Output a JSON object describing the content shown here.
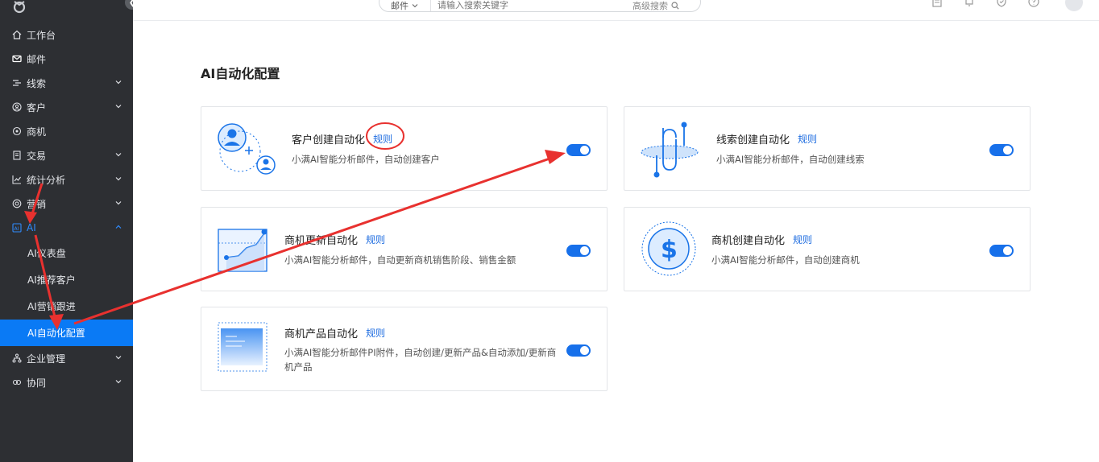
{
  "search": {
    "type_label": "邮件",
    "placeholder": "请输入搜索关键字",
    "advanced_label": "高级搜索"
  },
  "sidebar": {
    "items": [
      {
        "label": "工作台"
      },
      {
        "label": "邮件"
      },
      {
        "label": "线索"
      },
      {
        "label": "客户"
      },
      {
        "label": "商机"
      },
      {
        "label": "交易"
      },
      {
        "label": "统计分析"
      },
      {
        "label": "营销"
      },
      {
        "label": "AI"
      }
    ],
    "ai_sub": [
      {
        "label": "AI仪表盘"
      },
      {
        "label": "AI推荐客户"
      },
      {
        "label": "AI营销跟进"
      },
      {
        "label": "AI自动化配置"
      }
    ],
    "bottom_items": [
      {
        "label": "企业管理"
      },
      {
        "label": "协同"
      }
    ]
  },
  "page": {
    "title": "AI自动化配置"
  },
  "cards": [
    {
      "title": "客户创建自动化",
      "rule": "规则",
      "desc": "小满AI智能分析邮件，自动创建客户",
      "enabled": true
    },
    {
      "title": "线索创建自动化",
      "rule": "规则",
      "desc": "小满AI智能分析邮件，自动创建线索",
      "enabled": true
    },
    {
      "title": "商机更新自动化",
      "rule": "规则",
      "desc": "小满AI智能分析邮件，自动更新商机销售阶段、销售金额",
      "enabled": true
    },
    {
      "title": "商机创建自动化",
      "rule": "规则",
      "desc": "小满AI智能分析邮件，自动创建商机",
      "enabled": true
    },
    {
      "title": "商机产品自动化",
      "rule": "规则",
      "desc": "小满AI智能分析邮件PI附件，自动创建/更新产品&自动添加/更新商机产品",
      "enabled": true
    }
  ],
  "colors": {
    "sidebar_bg": "#2d2f33",
    "accent": "#0a7af5",
    "toggle_on": "#1770ea",
    "annotation": "#e8312f"
  }
}
